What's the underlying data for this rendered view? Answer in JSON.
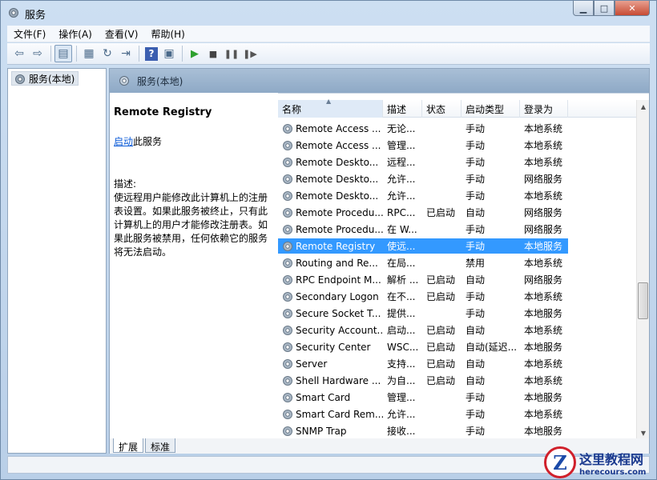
{
  "window": {
    "title": "服务"
  },
  "menu": [
    "文件(F)",
    "操作(A)",
    "查看(V)",
    "帮助(H)"
  ],
  "tree": {
    "node_label": "服务(本地)"
  },
  "main": {
    "header": "服务(本地)",
    "description": {
      "service_name": "Remote Registry",
      "start_link": "启动",
      "start_suffix": "此服务",
      "desc_label": "描述:",
      "desc_text": "使远程用户能修改此计算机上的注册表设置。如果此服务被终止，只有此计算机上的用户才能修改注册表。如果此服务被禁用，任何依赖它的服务将无法启动。"
    },
    "columns": [
      "名称",
      "描述",
      "状态",
      "启动类型",
      "登录为"
    ],
    "rows": [
      [
        "Remote Access ...",
        "无论...",
        "",
        "手动",
        "本地系统"
      ],
      [
        "Remote Access ...",
        "管理...",
        "",
        "手动",
        "本地系统"
      ],
      [
        "Remote Deskto...",
        "远程...",
        "",
        "手动",
        "本地系统"
      ],
      [
        "Remote Deskto...",
        "允许...",
        "",
        "手动",
        "网络服务"
      ],
      [
        "Remote Deskto...",
        "允许...",
        "",
        "手动",
        "本地系统"
      ],
      [
        "Remote Procedu...",
        "RPC...",
        "已启动",
        "自动",
        "网络服务"
      ],
      [
        "Remote Procedu...",
        "在 W...",
        "",
        "手动",
        "网络服务"
      ],
      [
        "Remote Registry",
        "使远...",
        "",
        "手动",
        "本地服务"
      ],
      [
        "Routing and Re...",
        "在局...",
        "",
        "禁用",
        "本地系统"
      ],
      [
        "RPC Endpoint M...",
        "解析 ...",
        "已启动",
        "自动",
        "网络服务"
      ],
      [
        "Secondary Logon",
        "在不...",
        "已启动",
        "手动",
        "本地系统"
      ],
      [
        "Secure Socket T...",
        "提供...",
        "",
        "手动",
        "本地服务"
      ],
      [
        "Security Account...",
        "启动...",
        "已启动",
        "自动",
        "本地系统"
      ],
      [
        "Security Center",
        "WSC...",
        "已启动",
        "自动(延迟...",
        "本地服务"
      ],
      [
        "Server",
        "支持...",
        "已启动",
        "自动",
        "本地系统"
      ],
      [
        "Shell Hardware ...",
        "为自...",
        "已启动",
        "自动",
        "本地系统"
      ],
      [
        "Smart Card",
        "管理...",
        "",
        "手动",
        "本地服务"
      ],
      [
        "Smart Card Rem...",
        "允许...",
        "",
        "手动",
        "本地系统"
      ],
      [
        "SNMP Trap",
        "接收...",
        "",
        "手动",
        "本地服务"
      ]
    ],
    "selected_row": 7,
    "tabs": [
      "扩展",
      "标准"
    ]
  },
  "watermark": {
    "cn": "这里教程网",
    "url": "herecours.com",
    "logo": "Z"
  },
  "colors": {
    "selection": "#3399ff",
    "header_bar": "#8ea9c6"
  }
}
